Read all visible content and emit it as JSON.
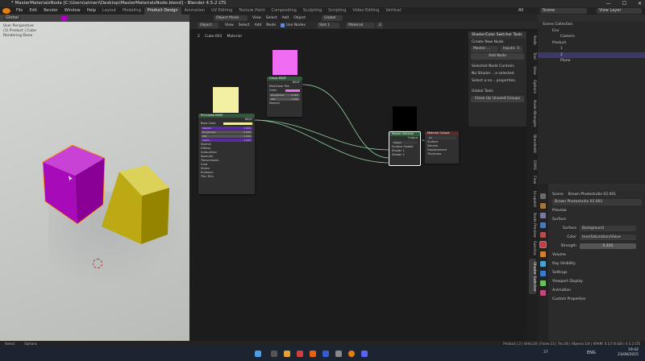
{
  "window": {
    "title": "* MasterMaterialsNode [C:\\Users\\aimeri\\Desktop\\MasterMaterialsNode.blend] - Blender 4.5.2 LTS",
    "controls": [
      "—",
      "☐",
      "✕"
    ]
  },
  "menubar": {
    "menus": [
      "File",
      "Edit",
      "Render",
      "Window",
      "Help"
    ],
    "workspaces": [
      "Layout",
      "Modeling",
      "Product Design",
      "Animation",
      "UV Editing",
      "Texture Paint",
      "Compositing",
      "Sculpting",
      "Scripting",
      "Video Editing",
      "Vertical"
    ],
    "active_workspace": "Product Design",
    "scene": "Scene",
    "view_layer": "View Layer",
    "all_label": "All"
  },
  "viewport": {
    "transform": "Global",
    "mode": "Object Mode",
    "menus": [
      "View",
      "Select",
      "Add",
      "Object"
    ],
    "overlay_text": [
      "User Perspective",
      "(1) Product | Cube",
      "Rendering Done"
    ]
  },
  "node_editor": {
    "type": "Object",
    "menus": [
      "View",
      "Select",
      "Add",
      "Node"
    ],
    "use_nodes": "Use Nodes",
    "slot": "Slot 1",
    "material": "Material",
    "users": "2",
    "transform": "Global",
    "breadcrumb": [
      "2",
      "Cube.001",
      "Material"
    ],
    "nodes": {
      "principled": {
        "title": "Principled BSDF",
        "output": "BSDF",
        "rows": [
          "Base Color",
          "Metallic",
          "Roughness",
          "IOR",
          "Alpha",
          "Normal"
        ],
        "values": [
          "1.000",
          "0.500",
          "1.500",
          "1.000"
        ],
        "subpanels": [
          "Diffuse",
          "Subsurface",
          "Specular",
          "Transmission",
          "Coat",
          "Sheen",
          "Emission",
          "Thin Film"
        ]
      },
      "pink": {
        "title": "Group BSDF",
        "output": "BSDF",
        "rows": [
          "MultiColor Mix",
          "Color",
          "Roughness",
          "IOR",
          "Normal"
        ],
        "values": [
          "0.200",
          "1.500"
        ]
      },
      "group": {
        "title": "Master Material",
        "output": "Output",
        "rows": [
          "Master",
          "Surface",
          "Volume",
          "Displacement",
          "Thickness"
        ]
      },
      "output": {
        "title": "Material Output",
        "option": "All",
        "rows": [
          "Surface",
          "Volume",
          "Displacement",
          "Thickness"
        ]
      },
      "inputs": [
        "Master",
        "Surface Shader",
        "Shader 1",
        "Shader 2"
      ]
    }
  },
  "npanel": {
    "title": "Shader/Color Switcher Tools",
    "create_new": "Create New Node",
    "master_field": "Master ...",
    "inputs": "Inputs: 3",
    "add_node": "Add Node",
    "selected_controls": "Selected Node Controls",
    "no_shader": "No Shader ...e selected.",
    "select_hint": "Select a no... properties.",
    "global_tools": "Global Tools",
    "cleanup": "Clean Up Unused Groups"
  },
  "sidebar_tabs": [
    "Node",
    "Tool",
    "View",
    "Options",
    "Node Wrangler",
    "Blenderkit",
    "ERRS",
    "Flow",
    "Ucupaint",
    "Node Preview",
    "Sanctus",
    "Shader Switcher"
  ],
  "outliner": {
    "root": "Scene Collection",
    "items": [
      {
        "label": "Env",
        "level": 1
      },
      {
        "label": "Camera",
        "level": 2
      },
      {
        "label": "Product",
        "level": 1
      },
      {
        "label": "1",
        "level": 2
      },
      {
        "label": "2",
        "level": 2
      },
      {
        "label": "Plane",
        "level": 2
      }
    ]
  },
  "properties": {
    "scene": "Scene",
    "world": "Brown Photostudio 02.001",
    "world_field": "Brown Photostudio 02.001",
    "sections": [
      "Preview",
      "Surface",
      "Volume",
      "Ray Visibility",
      "Settings",
      "Viewport Display",
      "Animation",
      "Custom Properties"
    ],
    "surface_label": "Surface",
    "surface_value": "Background",
    "color_label": "Color",
    "color_value": "Hue/Saturation/Value",
    "strength_label": "Strength",
    "strength_value": "0.400"
  },
  "statusbar": {
    "left": [
      "Select",
      "Options"
    ],
    "right": "Product | 2 | Verts:20 | Faces:13 | Tris:26 | Objects:1/4 | VRAM: 0.1/7.8 GiB | 4.5.2 LTS"
  },
  "taskbar": {
    "lang": "ENG",
    "time": "19:42",
    "date": "23/08/2025",
    "temp": "37"
  },
  "colors": {
    "accent_purple": "#b000c8",
    "cube_magenta": "#b010c0",
    "cube_gold": "#c9b010",
    "selection": "#3a3a6a",
    "node_green": "#2f5a3a",
    "node_red": "#5a2b2b",
    "link": "#8fd19e"
  }
}
